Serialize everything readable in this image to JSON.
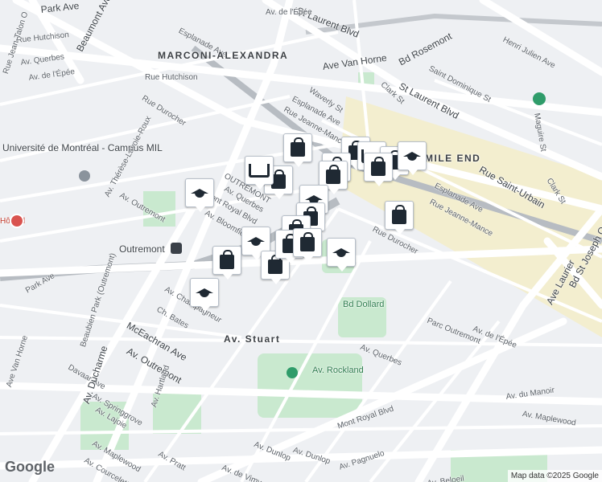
{
  "map": {
    "area_labels": [
      "MARCONI-ALEXANDRA",
      "MILE END"
    ],
    "street_labels": [
      "Park Ave",
      "Rue Hutchison",
      "Esplanade Ave",
      "St Laurent Blvd",
      "Av. Querbes",
      "Beaumont Ave",
      "Av. de l'Épée",
      "Ave Van Horne",
      "Bd Rosemont",
      "Henri Julien Ave",
      "St Laurent Blvd",
      "Saint Dominique St",
      "Rue Hutchison",
      "Rue Durocher",
      "Waverly St",
      "Clark St",
      "Esplanade Ave",
      "Rue Jeanne-Mance",
      "Maguire St",
      "Rue Saint-Urbain",
      "Rue Jean-Talon O",
      "Université de Montréal - Campus MIL",
      "Av. Thérèse-Lavoie-Roux",
      "Av. Outremont",
      "Outremont",
      "Esplanade Ave",
      "Rue Jeanne-Mance",
      "Rue Durocher",
      "Clark St",
      "Ave Laurier",
      "Bd St Joseph O",
      "Park Ave",
      "Ch. Bates",
      "Bd Dollard",
      "Parc Outremont",
      "Av. de l'Épée",
      "Av. Querbes",
      "Av. Outremont",
      "McEachran Ave",
      "Davaar Ave",
      "Av. Rockland",
      "Beaubien Park (Outremont)",
      "Av. Ducharme",
      "Ave Van Horne",
      "Av. du Manoir",
      "Av. Maplewood",
      "Mont Royal Blvd",
      "Av. Springgrove",
      "Av. Hartland",
      "Av. Lajoie",
      "Av. Dunlop",
      "Av. Pagnuelo",
      "Av. Maplewood",
      "Av. Pratt",
      "Av. Dunlop",
      "Av. Courcelette",
      "Av. de Vimy",
      "Av. Beloeil",
      "Mont Royal Blvd",
      "Av. Bloomfield",
      "Av. Champagneur",
      "Av. Stuart",
      "OUTREMONT",
      "Av. Querbes",
      "Av. de l'Épée"
    ],
    "station_label": "Outremont",
    "hospital_label": "Hôpital",
    "google_logo": "Google",
    "attribution": "Map data ©2025 Google",
    "colors": {
      "road": "#ffffff",
      "park": "#c9e9cf",
      "rail": "#b7bcc2",
      "highlight": "#f7e7a8",
      "pin_fill": "#1f2933"
    }
  },
  "pins": [
    {
      "type": "shopping"
    },
    {
      "type": "shopping"
    },
    {
      "type": "grocery"
    },
    {
      "type": "shopping"
    },
    {
      "type": "education"
    },
    {
      "type": "shopping"
    },
    {
      "type": "shopping"
    },
    {
      "type": "education"
    },
    {
      "type": "shopping"
    },
    {
      "type": "grocery"
    },
    {
      "type": "shopping"
    },
    {
      "type": "education"
    },
    {
      "type": "shopping"
    },
    {
      "type": "shopping"
    },
    {
      "type": "education"
    },
    {
      "type": "shopping"
    },
    {
      "type": "shopping"
    },
    {
      "type": "shopping"
    },
    {
      "type": "shopping"
    },
    {
      "type": "education"
    },
    {
      "type": "shopping"
    },
    {
      "type": "education"
    }
  ]
}
